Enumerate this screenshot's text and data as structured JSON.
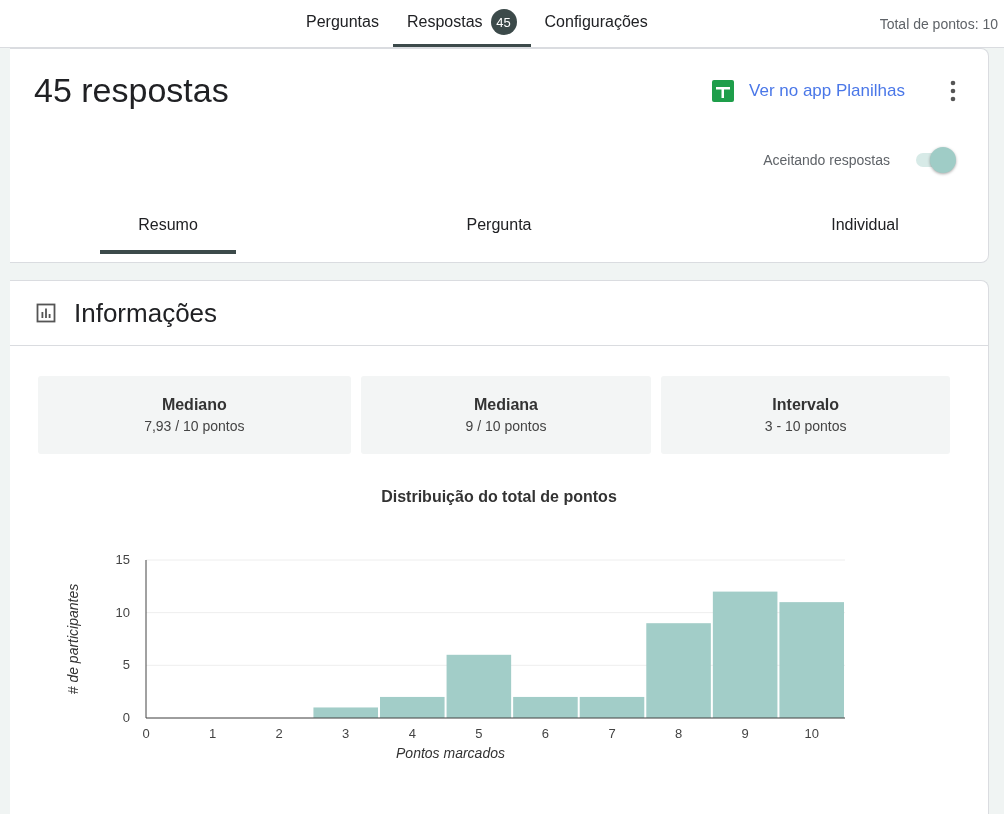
{
  "top_tabs": [
    {
      "label": "Perguntas",
      "selected": false
    },
    {
      "label": "Respostas",
      "selected": true,
      "badge": "45"
    },
    {
      "label": "Configurações",
      "selected": false
    }
  ],
  "total_points": "Total de pontos: 10",
  "responses_title": "45 respostas",
  "sheets_link": "Ver no app Planilhas",
  "accepting": {
    "label": "Aceitando respostas",
    "on": true
  },
  "view_tabs": [
    {
      "label": "Resumo",
      "selected": true
    },
    {
      "label": "Pergunta",
      "selected": false
    },
    {
      "label": "Individual",
      "selected": false
    }
  ],
  "insights": {
    "title": "Informações",
    "stats": [
      {
        "label": "Mediano",
        "value": "7,93 / 10 pontos"
      },
      {
        "label": "Mediana",
        "value": "9 / 10 pontos"
      },
      {
        "label": "Intervalo",
        "value": "3 - 10 pontos"
      }
    ],
    "chart_data": {
      "type": "bar",
      "title": "Distribuição do total de pontos",
      "xlabel": "Pontos marcados",
      "ylabel": "# de participantes",
      "x": [
        3,
        4,
        5,
        6,
        7,
        8,
        9,
        10
      ],
      "series": [
        {
          "color": "#a2cdc8",
          "values": [
            1,
            2,
            6,
            2,
            2,
            9,
            12,
            11
          ]
        }
      ],
      "xlim": [
        0,
        10.5
      ],
      "ylim": [
        0,
        15
      ],
      "xticks": [
        0,
        1,
        2,
        3,
        4,
        5,
        6,
        7,
        8,
        9,
        10
      ],
      "yticks": [
        0,
        5,
        10,
        15
      ]
    }
  }
}
